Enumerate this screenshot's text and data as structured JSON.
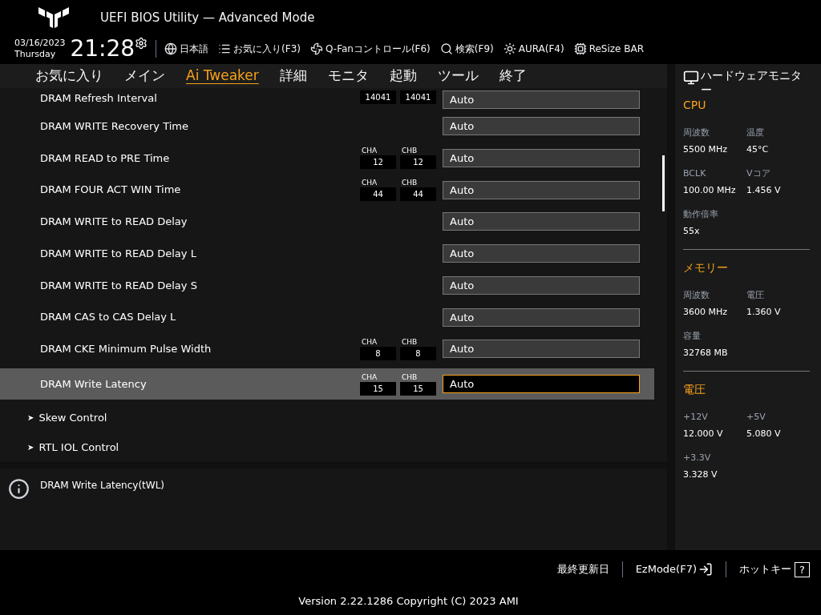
{
  "header": {
    "title": "UEFI BIOS Utility — Advanced Mode",
    "date": "03/16/2023",
    "day": "Thursday",
    "time": "21:28",
    "toolbar": [
      {
        "kind": "language",
        "label": "日本語"
      },
      {
        "kind": "favorites",
        "label": "お気に入り(F3)"
      },
      {
        "kind": "fan",
        "label": "Q-Fanコントロール(F6)"
      },
      {
        "kind": "search",
        "label": "検索(F9)"
      },
      {
        "kind": "aura",
        "label": "AURA(F4)"
      },
      {
        "kind": "resize",
        "label": "ReSize BAR"
      }
    ]
  },
  "tabs": [
    {
      "label": "お気に入り",
      "selected": false
    },
    {
      "label": "メイン",
      "selected": false
    },
    {
      "label": "Ai Tweaker",
      "selected": true
    },
    {
      "label": "詳細",
      "selected": false
    },
    {
      "label": "モニタ",
      "selected": false
    },
    {
      "label": "起動",
      "selected": false
    },
    {
      "label": "ツール",
      "selected": false
    },
    {
      "label": "終了",
      "selected": false
    }
  ],
  "settings": [
    {
      "kind": "setting",
      "label": "DRAM Refresh Interval",
      "channels": [
        {
          "value": "14041"
        },
        {
          "value": "14041"
        }
      ],
      "value": "Auto",
      "selected": false
    },
    {
      "kind": "setting",
      "label": "DRAM WRITE Recovery Time",
      "value": "Auto",
      "selected": false
    },
    {
      "kind": "setting",
      "label": "DRAM READ to PRE Time",
      "channels": [
        {
          "label": "CHA",
          "value": "12"
        },
        {
          "label": "CHB",
          "value": "12"
        }
      ],
      "value": "Auto",
      "selected": false
    },
    {
      "kind": "setting",
      "label": "DRAM FOUR ACT WIN Time",
      "channels": [
        {
          "label": "CHA",
          "value": "44"
        },
        {
          "label": "CHB",
          "value": "44"
        }
      ],
      "value": "Auto",
      "selected": false
    },
    {
      "kind": "setting",
      "label": "DRAM WRITE to READ Delay",
      "value": "Auto",
      "selected": false
    },
    {
      "kind": "setting",
      "label": "DRAM WRITE to READ Delay L",
      "value": "Auto",
      "selected": false
    },
    {
      "kind": "setting",
      "label": "DRAM WRITE to READ Delay S",
      "value": "Auto",
      "selected": false
    },
    {
      "kind": "setting",
      "label": "DRAM CAS to CAS Delay L",
      "value": "Auto",
      "selected": false
    },
    {
      "kind": "setting",
      "label": "DRAM CKE Minimum Pulse Width",
      "channels": [
        {
          "label": "CHA",
          "value": "8"
        },
        {
          "label": "CHB",
          "value": "8"
        }
      ],
      "value": "Auto",
      "selected": false
    },
    {
      "kind": "setting",
      "label": "DRAM Write Latency",
      "channels": [
        {
          "label": "CHA",
          "value": "15"
        },
        {
          "label": "CHB",
          "value": "15"
        }
      ],
      "value": "Auto",
      "selected": true
    },
    {
      "kind": "submenu",
      "label": "Skew Control",
      "arrow": "➤",
      "selected": false
    },
    {
      "kind": "submenu",
      "label": "RTL IOL Control",
      "arrow": "➤",
      "selected": false
    }
  ],
  "help": "DRAM Write Latency(tWL)",
  "hardware_monitor": {
    "title": "ハードウェアモニター",
    "sections": [
      {
        "title": "CPU",
        "items": [
          {
            "label": "周波数",
            "value": "5500 MHz"
          },
          {
            "label": "温度",
            "value": "45°C"
          },
          {
            "label": "BCLK",
            "value": "100.00 MHz"
          },
          {
            "label": "Vコア",
            "value": "1.456 V"
          },
          {
            "label": "動作倍率",
            "value": "55x"
          }
        ]
      },
      {
        "title": "メモリー",
        "items": [
          {
            "label": "周波数",
            "value": "3600 MHz"
          },
          {
            "label": "電圧",
            "value": "1.360 V"
          },
          {
            "label": "容量",
            "value": "32768 MB"
          }
        ]
      },
      {
        "title": "電圧",
        "items": [
          {
            "label": "+12V",
            "value": "12.000 V"
          },
          {
            "label": "+5V",
            "value": "5.080 V"
          },
          {
            "label": "+3.3V",
            "value": "3.328 V"
          }
        ]
      }
    ]
  },
  "footer": {
    "last_modified": "最終更新日",
    "ezmode": "EzMode(F7)",
    "hotkeys": "ホットキー",
    "hotkey_icon": "?",
    "version": "Version 2.22.1286 Copyright (C) 2023 AMI"
  }
}
